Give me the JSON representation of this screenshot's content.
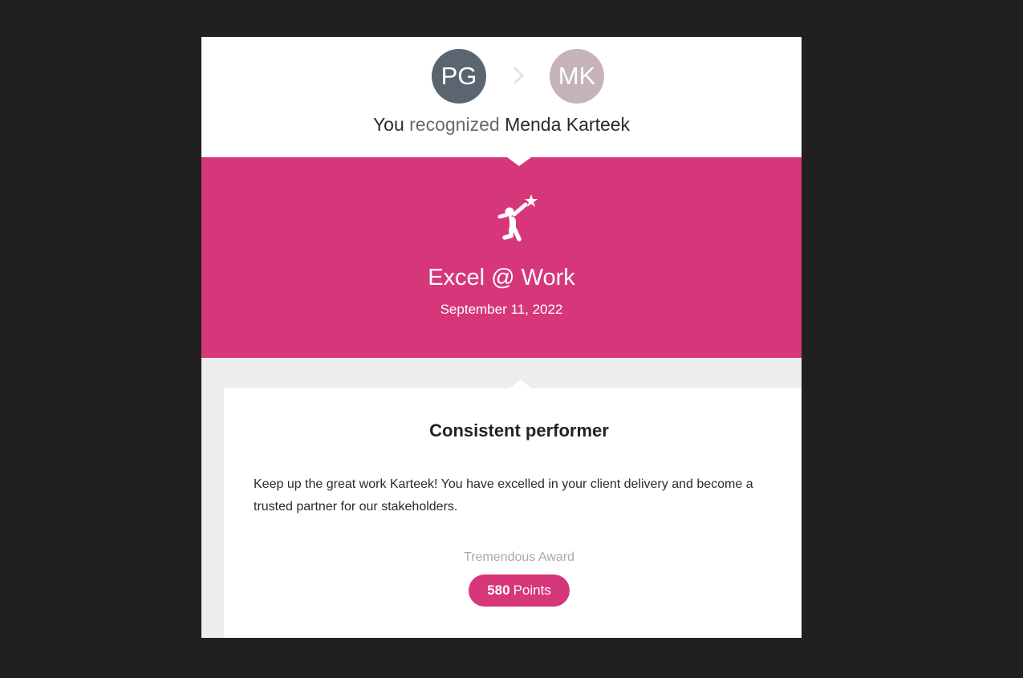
{
  "recognition": {
    "giver_initials": "PG",
    "receiver_initials": "MK",
    "giver_label": "You",
    "verb": "recognized",
    "receiver_name": "Menda Karteek"
  },
  "award": {
    "icon": "achiever-star-icon",
    "title": "Excel @ Work",
    "date": "September 11, 2022"
  },
  "message": {
    "title": "Consistent performer",
    "text": "Keep up the great work Karteek! You have excelled in your client delivery and become a trusted partner for our stakeholders.",
    "award_type": "Tremendous Award",
    "points_value": "580",
    "points_unit": "Points"
  },
  "colors": {
    "accent": "#d6377a",
    "giver_avatar": "#5a6570",
    "receiver_avatar": "#c5b3b7",
    "page_bg": "#202020",
    "section_bg": "#eeeeee"
  }
}
